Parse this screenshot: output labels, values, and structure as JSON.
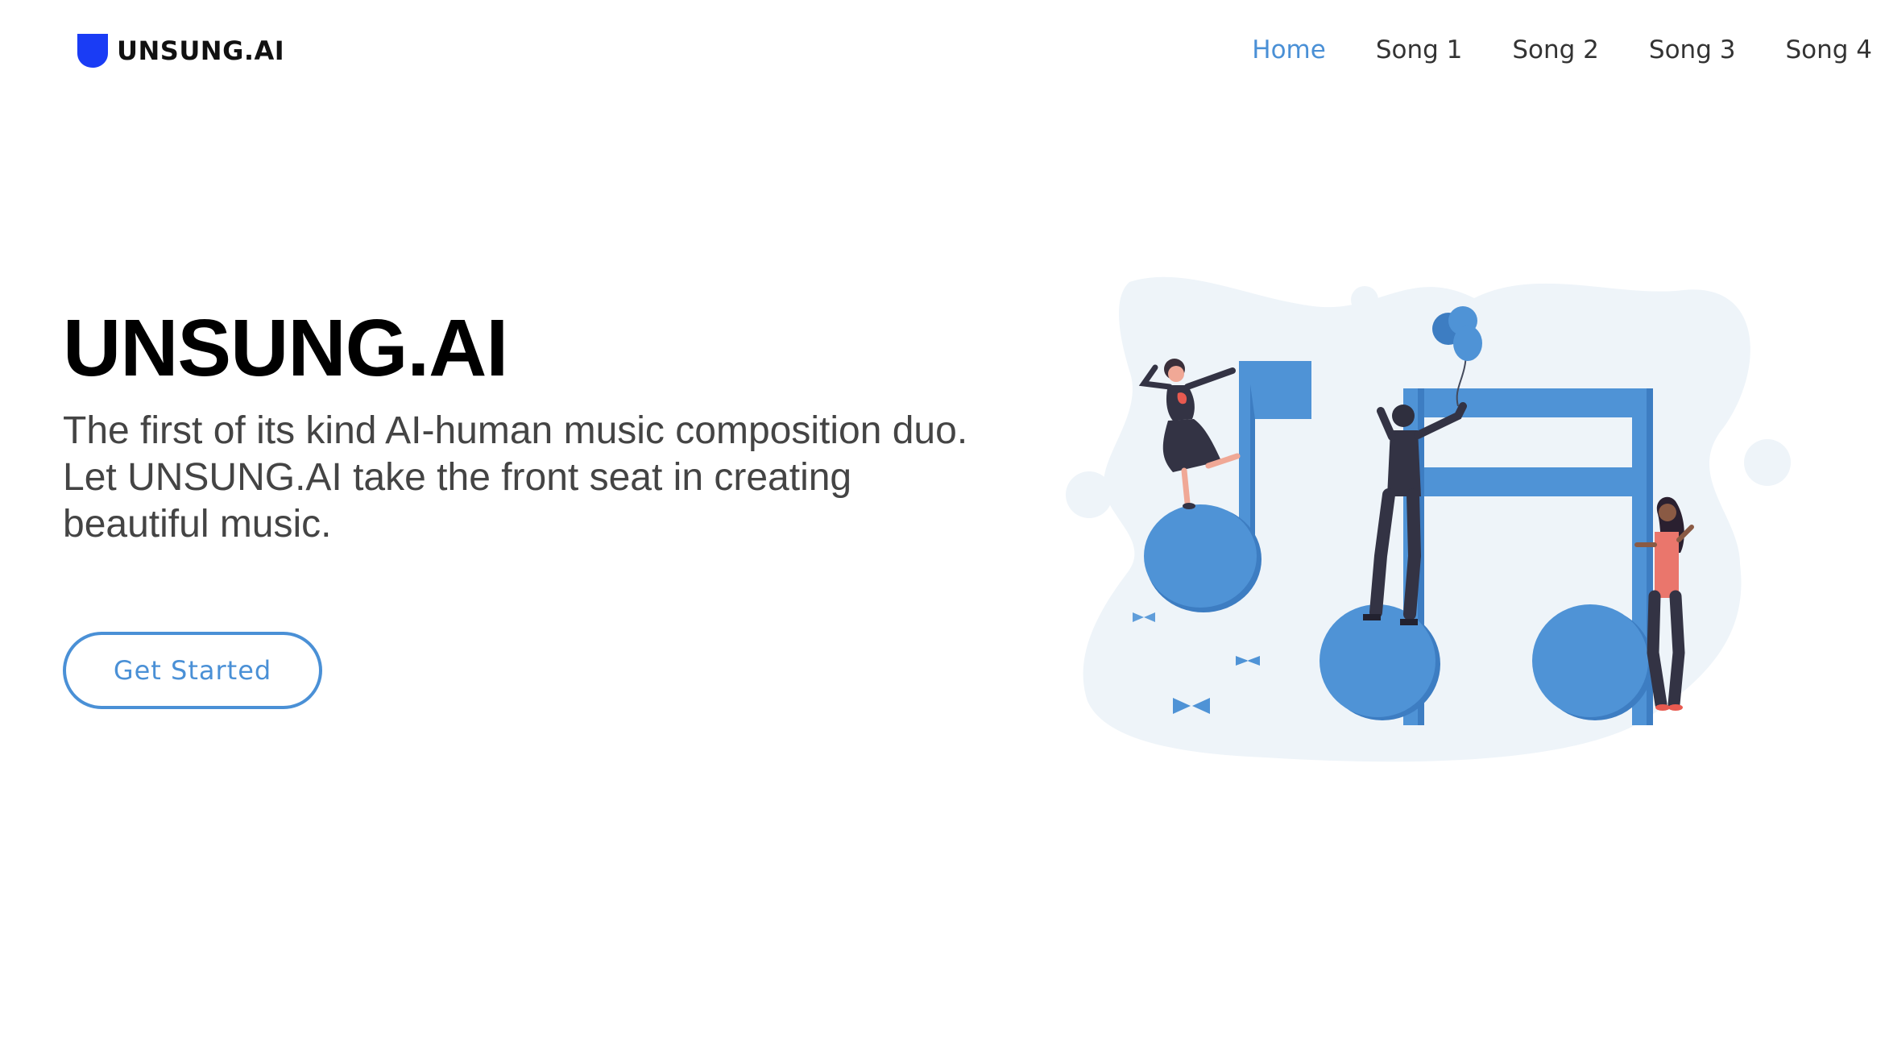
{
  "header": {
    "brand": "UNSUNG.AI",
    "nav": [
      {
        "label": "Home",
        "active": true
      },
      {
        "label": "Song 1",
        "active": false
      },
      {
        "label": "Song 2",
        "active": false
      },
      {
        "label": "Song 3",
        "active": false
      },
      {
        "label": "Song 4",
        "active": false
      }
    ]
  },
  "hero": {
    "title": "UNSUNG.AI",
    "subtitle": "The first of its kind AI-human music composition duo. Let UNSUNG.AI take the front seat in creating beautiful music.",
    "cta_label": "Get Started",
    "illustration_icon": "music-notes-illustration"
  },
  "colors": {
    "accent": "#4a90d6",
    "logo_blue": "#1a3cf5",
    "note_blue": "#4f93d6",
    "blob_bg": "#eef4f9",
    "text_dark": "#000000",
    "text_body": "#444444"
  }
}
